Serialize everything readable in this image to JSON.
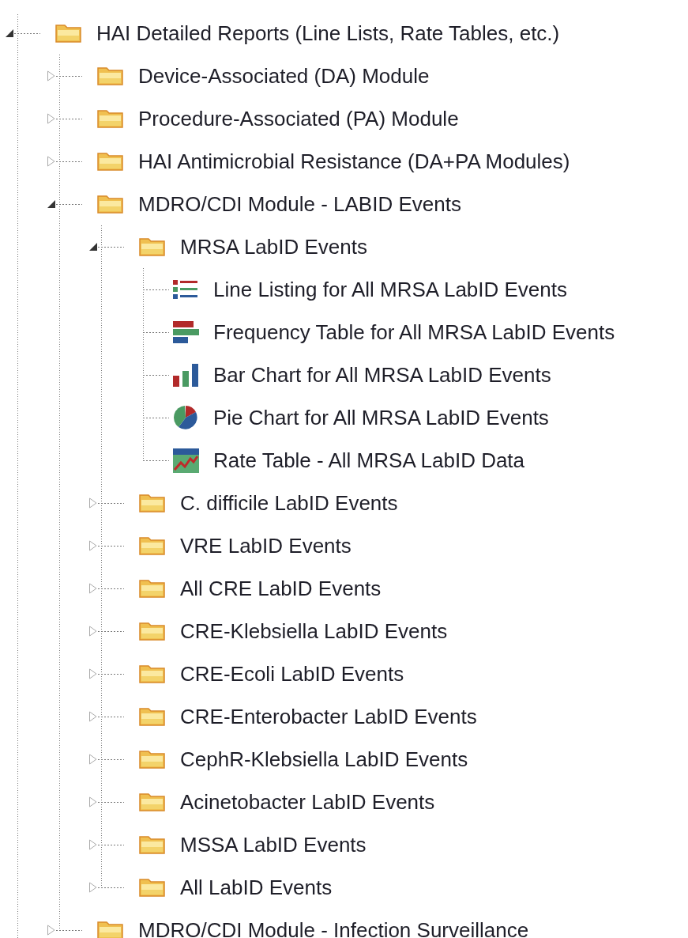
{
  "tree": [
    {
      "label": "HAI Detailed Reports (Line Lists, Rate Tables, etc.)",
      "kind": "folder",
      "expanded": true,
      "children": [
        {
          "label": "Device-Associated (DA) Module",
          "kind": "folder",
          "expanded": false
        },
        {
          "label": "Procedure-Associated (PA) Module",
          "kind": "folder",
          "expanded": false
        },
        {
          "label": "HAI Antimicrobial Resistance (DA+PA Modules)",
          "kind": "folder",
          "expanded": false
        },
        {
          "label": "MDRO/CDI Module - LABID Events",
          "kind": "folder",
          "expanded": true,
          "children": [
            {
              "label": "MRSA LabID Events",
              "kind": "folder",
              "expanded": true,
              "children": [
                {
                  "label": "Line Listing for All MRSA LabID Events",
                  "kind": "list"
                },
                {
                  "label": "Frequency Table for All MRSA LabID Events",
                  "kind": "frequency"
                },
                {
                  "label": "Bar Chart for All MRSA LabID Events",
                  "kind": "bar"
                },
                {
                  "label": "Pie Chart for All MRSA LabID Events",
                  "kind": "pie"
                },
                {
                  "label": "Rate Table - All MRSA LabID Data",
                  "kind": "rate"
                }
              ]
            },
            {
              "label": "C. difficile LabID Events",
              "kind": "folder",
              "expanded": false
            },
            {
              "label": "VRE LabID Events",
              "kind": "folder",
              "expanded": false
            },
            {
              "label": "All CRE LabID Events",
              "kind": "folder",
              "expanded": false
            },
            {
              "label": "CRE-Klebsiella LabID Events",
              "kind": "folder",
              "expanded": false
            },
            {
              "label": "CRE-Ecoli LabID Events",
              "kind": "folder",
              "expanded": false
            },
            {
              "label": "CRE-Enterobacter LabID Events",
              "kind": "folder",
              "expanded": false
            },
            {
              "label": "CephR-Klebsiella LabID Events",
              "kind": "folder",
              "expanded": false
            },
            {
              "label": "Acinetobacter LabID Events",
              "kind": "folder",
              "expanded": false
            },
            {
              "label": "MSSA LabID Events",
              "kind": "folder",
              "expanded": false
            },
            {
              "label": "All LabID Events",
              "kind": "folder",
              "expanded": false
            }
          ]
        },
        {
          "label": "MDRO/CDI Module - Infection Surveillance",
          "kind": "folder",
          "expanded": false
        }
      ]
    }
  ]
}
